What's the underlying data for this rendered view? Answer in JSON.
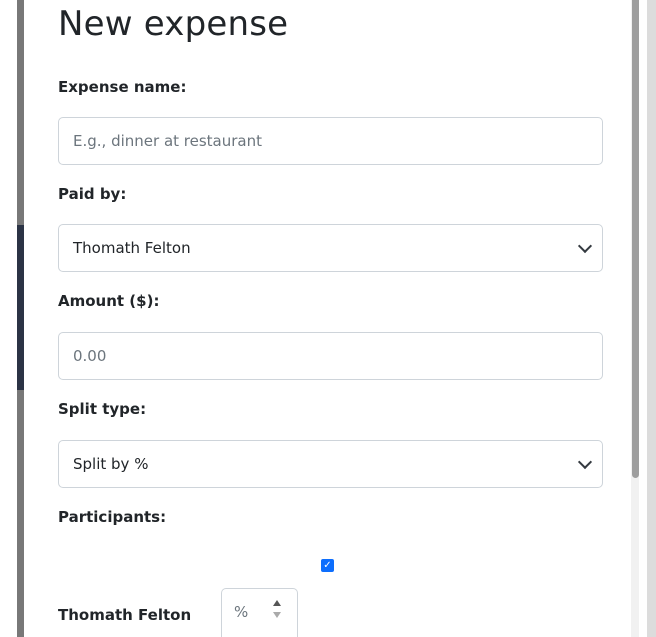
{
  "form": {
    "title": "New expense",
    "expense_name": {
      "label": "Expense name:",
      "value": "",
      "placeholder": "E.g., dinner at restaurant"
    },
    "paid_by": {
      "label": "Paid by:",
      "selected": "Thomath Felton"
    },
    "amount": {
      "label": "Amount ($):",
      "value": "",
      "placeholder": "0.00"
    },
    "split_type": {
      "label": "Split type:",
      "selected": "Split by %"
    },
    "participants": {
      "label": "Participants:",
      "items": [
        {
          "name": "Thomath Felton",
          "checked": true,
          "percent_placeholder": "%"
        }
      ]
    }
  },
  "colors": {
    "checkbox": "#0d6efd",
    "border": "#ced4da",
    "text": "#212529",
    "placeholder": "#6c757d"
  }
}
